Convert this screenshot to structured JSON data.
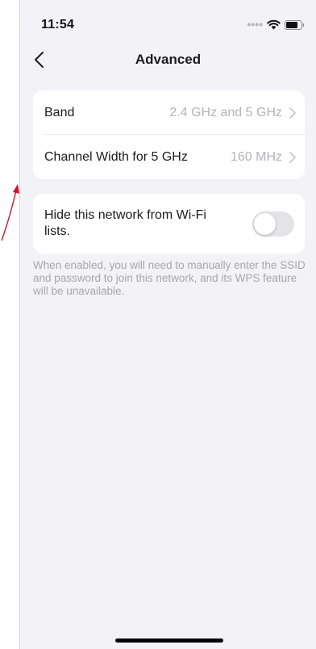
{
  "status_bar": {
    "time": "11:54",
    "signal_icon": "signal-dots-icon",
    "wifi_icon": "wifi-icon",
    "battery_icon": "battery-icon"
  },
  "nav": {
    "back_icon": "chevron-left-icon",
    "title": "Advanced"
  },
  "settings": {
    "band": {
      "label": "Band",
      "value": "2.4 GHz and 5 GHz"
    },
    "channel_width": {
      "label": "Channel Width for 5 GHz",
      "value": "160 MHz"
    }
  },
  "hide_network": {
    "label": "Hide this network from Wi-Fi lists.",
    "enabled": false
  },
  "footnote": "When enabled, you will need to manually enter the SSID and password to join this network, and its WPS feature will be unavailable.",
  "colors": {
    "background": "#f3f3f7",
    "card": "#ffffff",
    "secondary_text": "#b3b3b8",
    "annotation": "#d0142c"
  }
}
